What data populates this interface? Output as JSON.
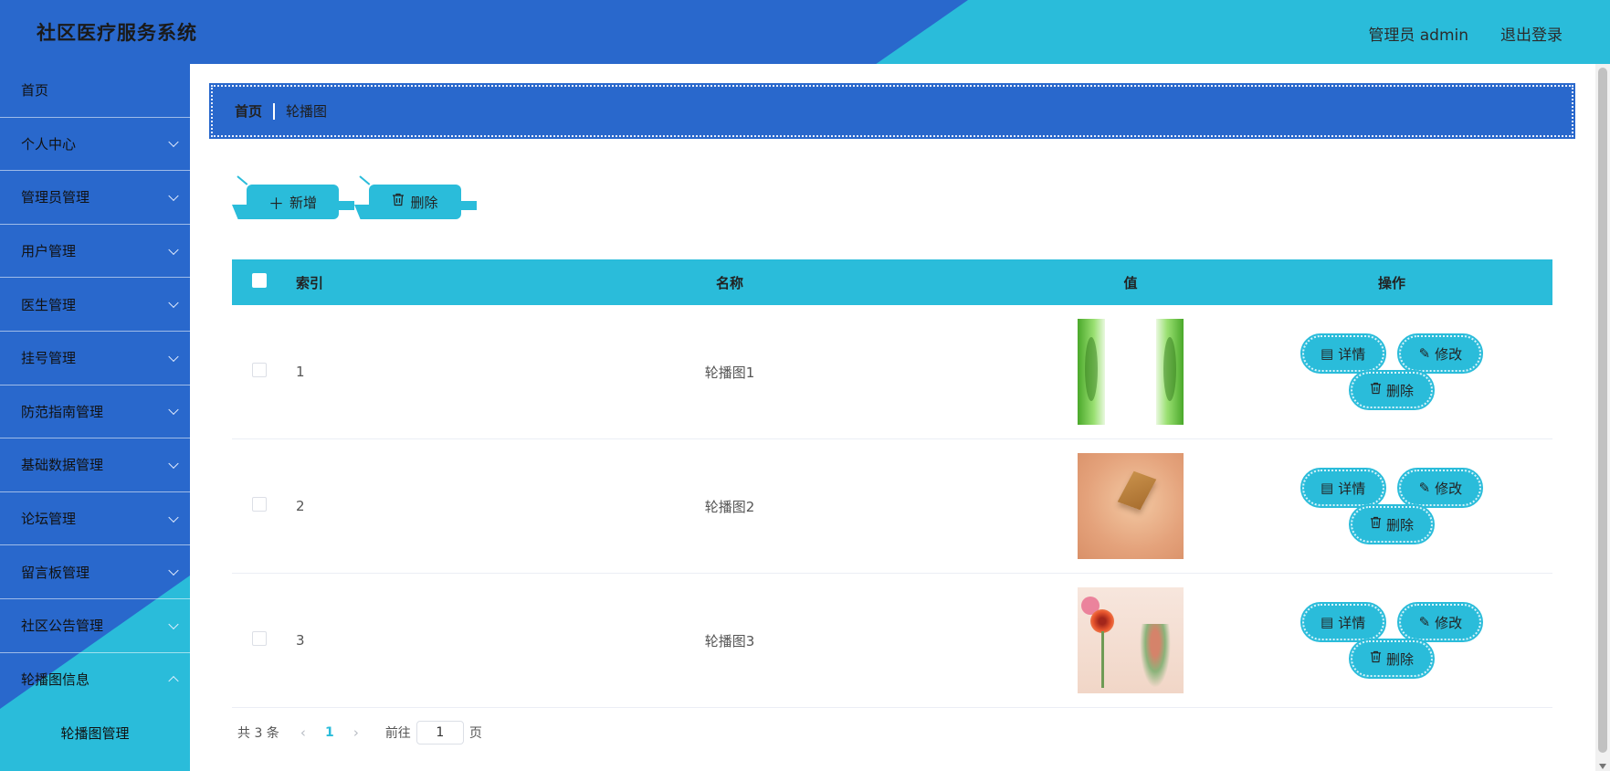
{
  "header": {
    "title": "社区医疗服务系统",
    "user_label": "管理员 admin",
    "logout_label": "退出登录"
  },
  "sidebar": {
    "items": [
      {
        "label": "首页"
      },
      {
        "label": "个人中心"
      },
      {
        "label": "管理员管理"
      },
      {
        "label": "用户管理"
      },
      {
        "label": "医生管理"
      },
      {
        "label": "挂号管理"
      },
      {
        "label": "防范指南管理"
      },
      {
        "label": "基础数据管理"
      },
      {
        "label": "论坛管理"
      },
      {
        "label": "留言板管理"
      },
      {
        "label": "社区公告管理"
      },
      {
        "label": "轮播图信息"
      }
    ],
    "sub_item": "轮播图管理"
  },
  "breadcrumb": {
    "home": "首页",
    "current": "轮播图"
  },
  "toolbar": {
    "add_label": "新增",
    "delete_label": "删除"
  },
  "table": {
    "columns": [
      "索引",
      "名称",
      "值",
      "操作"
    ],
    "rows": [
      {
        "index": "1",
        "name": "轮播图1"
      },
      {
        "index": "2",
        "name": "轮播图2"
      },
      {
        "index": "3",
        "name": "轮播图3"
      }
    ],
    "actions": {
      "detail": "详情",
      "edit": "修改",
      "delete": "删除"
    }
  },
  "pagination": {
    "total": "共 3 条",
    "current_page": "1",
    "goto_label": "前往",
    "goto_value": "1",
    "page_suffix": "页"
  },
  "colors": {
    "primary_blue": "#2968CC",
    "accent_cyan": "#2ABCDA"
  }
}
